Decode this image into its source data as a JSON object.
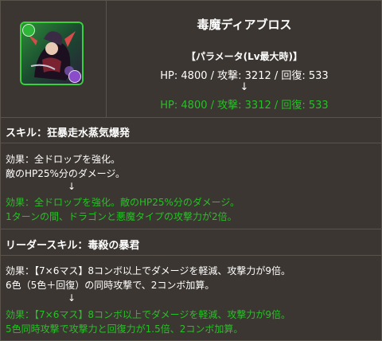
{
  "monster": {
    "name": "毒魔ディアブロス",
    "param_header": "【パラメータ(Lv最大時)】",
    "stats_base": "HP: 4800 / 攻撃: 3212 / 回復: 533",
    "arrow": "↓",
    "stats_plus": "HP: 4800 / 攻撃: 3312 / 回復: 533"
  },
  "skill": {
    "title": "スキル：狂暴走水蒸気爆発",
    "effect_line1": "効果：全ドロップを強化。",
    "effect_line2": "敵のHP25%分のダメージ。",
    "arrow": "↓",
    "new_line1": "効果：全ドロップを強化。敵のHP25%分のダメージ。",
    "new_line2": "1ターンの間、ドラゴンと悪魔タイプの攻撃力が2倍。"
  },
  "leader": {
    "title": "リーダースキル：毒殺の暴君",
    "effect_line1": "効果：【7×6マス】8コンボ以上でダメージを軽減、攻撃力が9倍。",
    "effect_line2": "6色（5色＋回復）の同時攻撃で、2コンボ加算。",
    "arrow": "↓",
    "new_line1": "効果：【7×6マス】8コンボ以上でダメージを軽減、攻撃力が9倍。",
    "new_line2": "5色同時攻撃で攻撃力と回復力が1.5倍、2コンボ加算。"
  },
  "colors": {
    "background": "#3b3631",
    "border": "#5a534b",
    "text": "#ffffff",
    "highlight": "#27c127"
  }
}
